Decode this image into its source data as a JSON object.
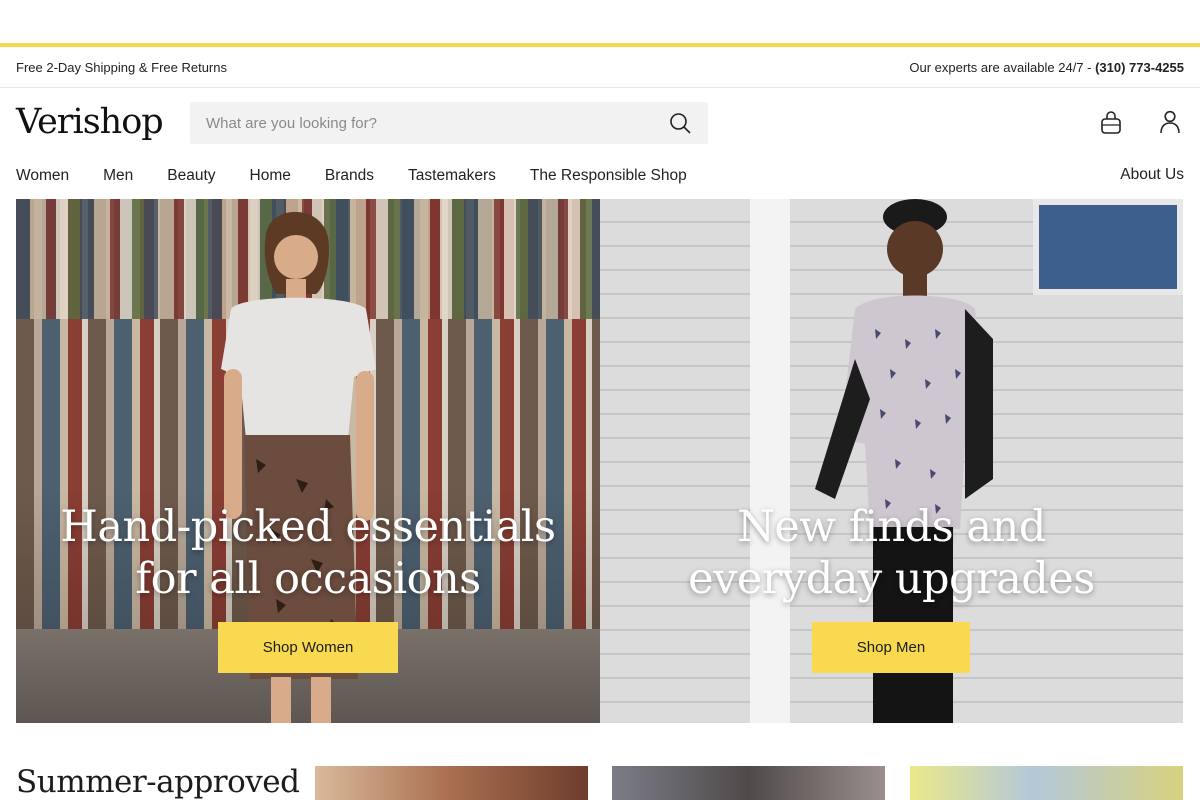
{
  "promo": {
    "shipping": "Free 2-Day Shipping & Free Returns",
    "experts_text": "Our experts are available 24/7 - ",
    "phone": "(310) 773-4255"
  },
  "header": {
    "logo": "Verishop",
    "search_placeholder": "What are you looking for?",
    "icons": {
      "search": "search-icon",
      "bag": "shopping-bag-icon",
      "account": "user-icon"
    }
  },
  "nav": {
    "items": [
      "Women",
      "Men",
      "Beauty",
      "Home",
      "Brands",
      "Tastemakers",
      "The Responsible Shop"
    ],
    "about": "About Us"
  },
  "hero": {
    "women": {
      "title_line1": "Hand-picked essentials",
      "title_line2": "for all occasions",
      "button": "Shop Women"
    },
    "men": {
      "title_line1": "New finds and",
      "title_line2": "everyday upgrades",
      "button": "Shop Men"
    }
  },
  "section": {
    "title": "Summer-approved"
  },
  "colors": {
    "accent": "#f7d64a",
    "button": "#f9d94f",
    "text": "#1c1c1c",
    "search_bg": "#f2f2f2"
  }
}
